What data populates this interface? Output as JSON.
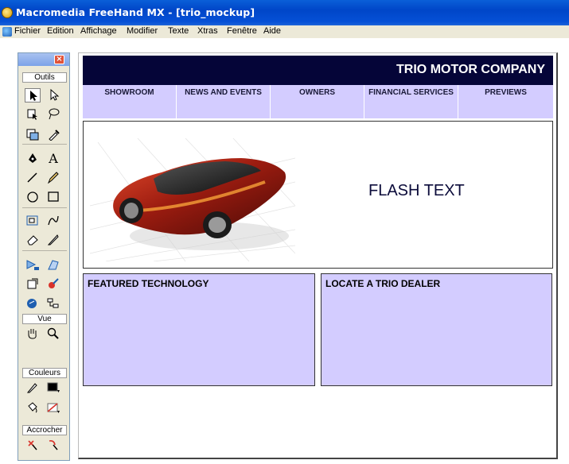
{
  "window": {
    "title": "Macromedia FreeHand MX - [trio_mockup]"
  },
  "menu": [
    "Fichier",
    "Edition",
    "Affichage",
    "Modifier",
    "Texte",
    "Xtras",
    "Fenêtre",
    "Aide"
  ],
  "tools_panel": {
    "close_glyph": "×",
    "section_tools": "Outils",
    "section_view": "Vue",
    "section_colors": "Couleurs",
    "section_snap": "Accrocher"
  },
  "page": {
    "company": "TRIO MOTOR COMPANY",
    "nav": [
      "SHOWROOM",
      "NEWS AND EVENTS",
      "OWNERS",
      "FINANCIAL SERVICES",
      "PREVIEWS"
    ],
    "flash_text": "FLASH TEXT",
    "featured_title": "FEATURED TECHNOLOGY",
    "dealer_title": "LOCATE A TRIO DEALER"
  },
  "colors": {
    "header_bg": "#050538",
    "nav_bg": "#d3ccff",
    "box_bg": "#d3ccff",
    "titlebar": "#0046c8"
  }
}
